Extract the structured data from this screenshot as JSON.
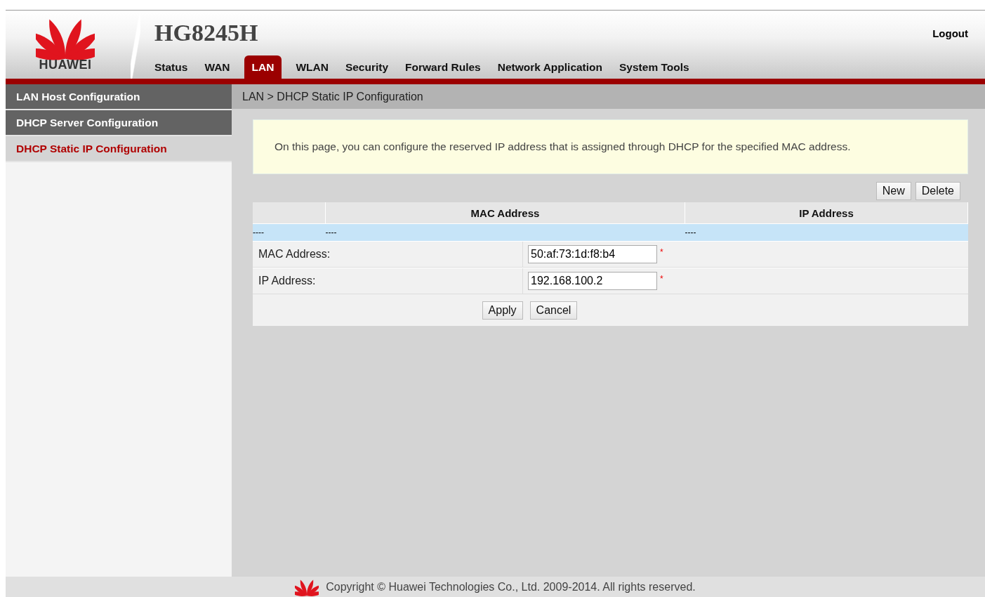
{
  "header": {
    "model": "HG8245H",
    "logo_text": "HUAWEI",
    "logout": "Logout"
  },
  "tabs": [
    {
      "label": "Status",
      "selected": false
    },
    {
      "label": "WAN",
      "selected": false
    },
    {
      "label": "LAN",
      "selected": true
    },
    {
      "label": "WLAN",
      "selected": false
    },
    {
      "label": "Security",
      "selected": false
    },
    {
      "label": "Forward Rules",
      "selected": false
    },
    {
      "label": "Network Application",
      "selected": false
    },
    {
      "label": "System Tools",
      "selected": false
    }
  ],
  "sidebar": {
    "items": [
      {
        "label": "LAN Host Configuration",
        "selected": false
      },
      {
        "label": "DHCP Server Configuration",
        "selected": false
      },
      {
        "label": "DHCP Static IP Configuration",
        "selected": true
      }
    ]
  },
  "breadcrumb": "LAN > DHCP Static IP Configuration",
  "notice": "On this page, you can configure the reserved IP address that is assigned through DHCP for the specified MAC address.",
  "table_buttons": [
    "New",
    "Delete"
  ],
  "table": {
    "columns": [
      "",
      "MAC Address",
      "IP Address"
    ],
    "rows": [
      [
        "----",
        "----",
        "----"
      ]
    ]
  },
  "form": {
    "fields": [
      {
        "label": "MAC Address:",
        "value": "50:af:73:1d:f8:b4",
        "required_mark": "*"
      },
      {
        "label": "IP Address:",
        "value": "192.168.100.2",
        "required_mark": "*"
      }
    ],
    "buttons": [
      "Apply",
      "Cancel"
    ]
  },
  "footer": "Copyright © Huawei Technologies Co., Ltd. 2009-2014. All rights reserved."
}
